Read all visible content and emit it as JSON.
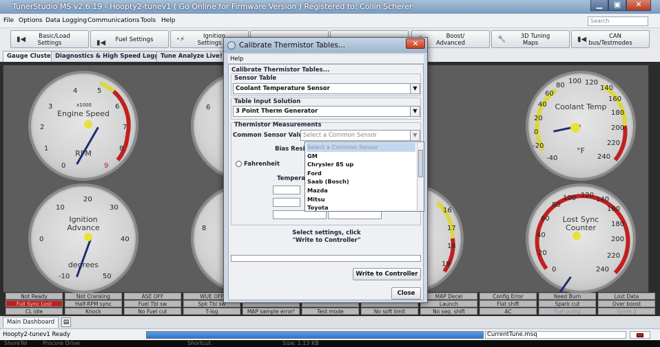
{
  "window": {
    "title": "TunerStudio MS v2.6.19 - Hoopty2-tunev1 ( Go Online for Firmware Version ) Registered to: Collin Scherer",
    "minimize": "▁",
    "restore": "▣",
    "close": "✕"
  },
  "menu": [
    "File",
    "Options",
    "Data Logging",
    "Communications",
    "Tools",
    "Help"
  ],
  "search": {
    "placeholder": "Search"
  },
  "toolbar": [
    {
      "label": "Basic/Load\nSettings",
      "icon": "▮◀"
    },
    {
      "label": "Fuel Settings",
      "icon": "▮◀"
    },
    {
      "label": "Ignition\nSettings",
      "icon": "⁃⚡"
    },
    {
      "label": "",
      "icon": ""
    },
    {
      "label": "",
      "icon": ""
    },
    {
      "label": "Boost/\nAdvanced",
      "icon": "🔨"
    },
    {
      "label": "3D Tuning\nMaps",
      "icon": "🔧"
    },
    {
      "label": "CAN\nbus/Testmodes",
      "icon": "▮◀"
    }
  ],
  "tabs": [
    "Gauge Cluster",
    "Diagnostics & High Speed Loggers",
    "Tune Analyze Live! - Tu"
  ],
  "gauges": {
    "rpm": {
      "title": "Engine Speed",
      "unit": "RPM",
      "scale": "x1000",
      "ticks": [
        "0",
        "1",
        "2",
        "3",
        "4",
        "5",
        "6",
        "7",
        "8",
        "9"
      ]
    },
    "ignition": {
      "title": "Ignition",
      "title2": "Advance",
      "unit": "degrees",
      "ticks": [
        "-10",
        "0",
        "10",
        "20",
        "30",
        "40",
        "50"
      ]
    },
    "clt": {
      "title": "Coolant Temp",
      "unit": "°F",
      "ticks": [
        "-40",
        "-20",
        "0",
        "20",
        "40",
        "60",
        "80",
        "100",
        "120",
        "140",
        "160",
        "180",
        "200",
        "220",
        "240"
      ]
    },
    "sync": {
      "title": "Lost Sync",
      "title2": "Counter",
      "ticks": [
        "0",
        "20",
        "40",
        "60",
        "80",
        "100",
        "120",
        "140",
        "160",
        "180",
        "200",
        "220",
        "240"
      ]
    },
    "partial_left": [
      "6",
      "",
      "8"
    ],
    "partial_right": [
      "16",
      "17",
      "18",
      "19"
    ]
  },
  "status_cells": [
    [
      "Not Ready",
      "Not Cranking",
      "ASE OFF",
      "WUE OFF",
      "",
      "",
      "",
      "MAP Decel",
      "Config Error",
      "Need Burn",
      "Lost Data"
    ],
    [
      "Full Sync Lost",
      "Half-RPM sync",
      "Fuel Tbl sw",
      "Spk Tbl sw",
      "",
      "",
      "",
      "Launch",
      "Flat shift",
      "Spark cut",
      "Over boost"
    ],
    [
      "CL idle",
      "Knock",
      "No Fuel cut",
      "T-log",
      "MAP sample error!",
      "Test mode",
      "No soft limit",
      "No seq. shift",
      "AC",
      "Fuel pump",
      "Spare 2"
    ]
  ],
  "dash_tab": "Main Dashboard",
  "statusbar": {
    "project": "Hoopty2-tunev1 Ready",
    "progress": 1.0,
    "file": "CurrentTune.msq"
  },
  "behind": {
    "a": "ShoreTel",
    "b": "Procore Drive",
    "c": "Shortcut",
    "d": "Size: 1.13 KB"
  },
  "dialog": {
    "title": "Calibrate Thermistor Tables...",
    "menu": "Help",
    "section": "Calibrate Thermistor Tables...",
    "sensor_table_label": "Sensor Table",
    "sensor_table": "Coolant Temperature Sensor",
    "input_solution_label": "Table Input Solution",
    "input_solution": "3 Point Therm Generator",
    "measurements_label": "Thermistor Measurements",
    "common_label": "Common Sensor Values",
    "common_value": "Select a Common Sensor",
    "bias_label": "Bias Resi",
    "fahrenheit": "Fahrenheit",
    "temp_label": "Tempera",
    "dropdown": [
      "Select a Common Sensor",
      "GM",
      "Chrysler 85 up",
      "Ford",
      "Saab (Bosch)",
      "Mazda",
      "Mitsu",
      "Toyota"
    ],
    "instructions1": "Select settings, click",
    "instructions2": "\"Write to Controller\"",
    "write_btn": "Write to Controller",
    "close_btn": "Close"
  }
}
